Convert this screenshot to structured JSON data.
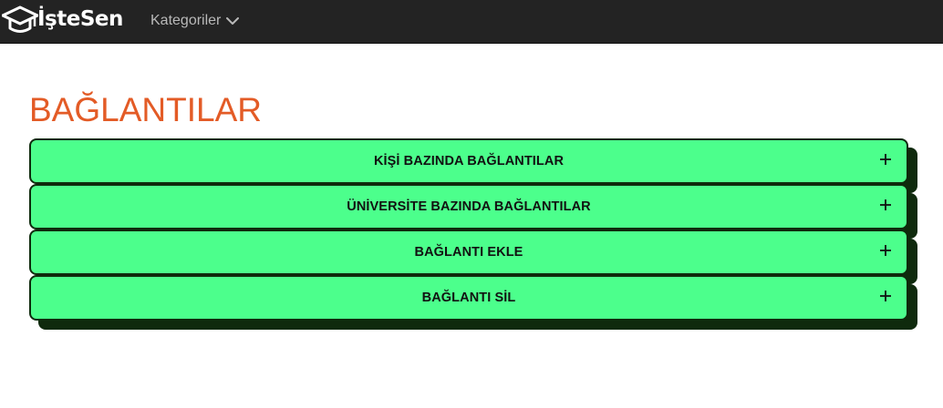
{
  "navbar": {
    "brand_text": "İşteSen",
    "brand_icon": "graduation-cap-icon",
    "categories_label": "Kategoriler",
    "categories_icon": "chevron-down-icon"
  },
  "page": {
    "title": "BAĞLANTILAR"
  },
  "accordion": {
    "expand_icon": "plus-icon",
    "items": [
      {
        "label": "KİŞİ BAZINDA BAĞLANTILAR"
      },
      {
        "label": "ÜNİVERSİTE BAZINDA BAĞLANTILAR"
      },
      {
        "label": "BAĞLANTI EKLE"
      },
      {
        "label": "BAĞLANTI SİL"
      }
    ]
  },
  "colors": {
    "navbar_bg": "#232323",
    "title": "#e35b26",
    "accordion_bg": "#4cff8c",
    "accordion_shadow": "#0f2a0d"
  }
}
